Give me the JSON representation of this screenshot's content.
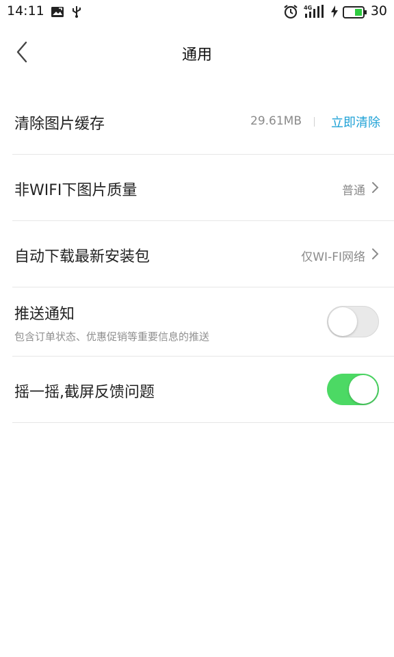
{
  "status_bar": {
    "time": "14:11",
    "battery_level": "30",
    "network": "4G",
    "icons": [
      "image-notification-icon",
      "usb-icon",
      "alarm-icon",
      "signal-icon",
      "charging-icon",
      "battery-icon"
    ]
  },
  "header": {
    "title": "通用",
    "back_icon": "chevron-left-icon"
  },
  "settings": {
    "clear_cache": {
      "label": "清除图片缓存",
      "size": "29.61MB",
      "action": "立即清除"
    },
    "image_quality": {
      "label": "非WIFI下图片质量",
      "value": "普通"
    },
    "auto_download": {
      "label": "自动下载最新安装包",
      "value": "仅WI-FI网络"
    },
    "push_notification": {
      "label": "推送通知",
      "description": "包含订单状态、优惠促销等重要信息的推送",
      "enabled": false
    },
    "shake_feedback": {
      "label": "摇一摇,截屏反馈问题",
      "enabled": true
    }
  },
  "colors": {
    "accent_link": "#1da1d6",
    "toggle_on": "#4cd964",
    "toggle_off": "#e9e9e9",
    "battery_fill": "#2ecc40"
  }
}
